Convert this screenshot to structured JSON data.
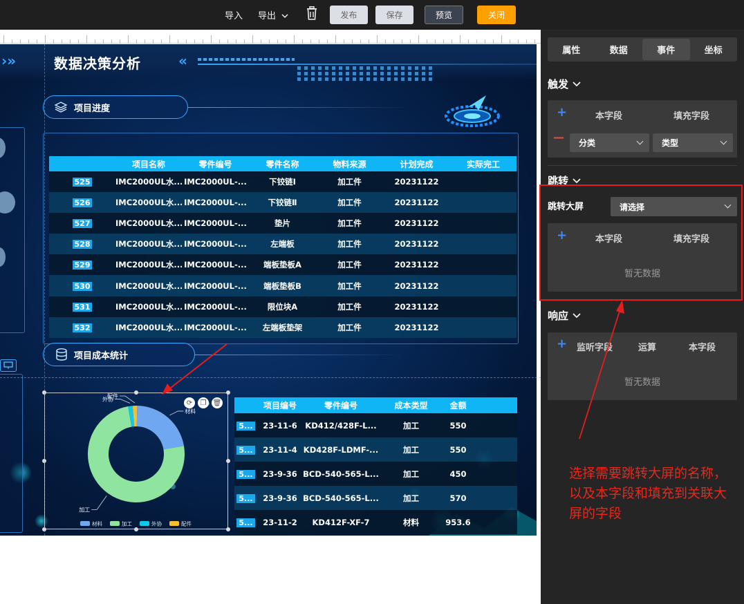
{
  "toolbar": {
    "import_label": "导入",
    "export_label": "导出",
    "publish_label": "发布",
    "save_label": "保存",
    "preview_label": "预览",
    "close_label": "关闭",
    "accent_orange": "#ff9f00"
  },
  "screen": {
    "title": "数据决策分析",
    "section_progress": "项目进度",
    "section_cost": "项目成本统计"
  },
  "progress_table": {
    "headers": [
      "",
      "项目名称",
      "零件编号",
      "零件名称",
      "物料来源",
      "计划完成",
      "实际完工"
    ],
    "rows": [
      {
        "id": "525",
        "name": "IMC2000UL水...",
        "part_no": "IMC2000UL-...",
        "part_name": "下铰链Ⅰ",
        "source": "加工件",
        "plan": "20231122",
        "actual": ""
      },
      {
        "id": "526",
        "name": "IMC2000UL水...",
        "part_no": "IMC2000UL-...",
        "part_name": "下铰链Ⅱ",
        "source": "加工件",
        "plan": "20231122",
        "actual": ""
      },
      {
        "id": "527",
        "name": "IMC2000UL水...",
        "part_no": "IMC2000UL-...",
        "part_name": "垫片",
        "source": "加工件",
        "plan": "20231122",
        "actual": ""
      },
      {
        "id": "528",
        "name": "IMC2000UL水...",
        "part_no": "IMC2000UL-...",
        "part_name": "左端板",
        "source": "加工件",
        "plan": "20231122",
        "actual": ""
      },
      {
        "id": "529",
        "name": "IMC2000UL水...",
        "part_no": "IMC2000UL-...",
        "part_name": "端板垫板A",
        "source": "加工件",
        "plan": "20231122",
        "actual": ""
      },
      {
        "id": "530",
        "name": "IMC2000UL水...",
        "part_no": "IMC2000UL-...",
        "part_name": "端板垫板B",
        "source": "加工件",
        "plan": "20231122",
        "actual": ""
      },
      {
        "id": "531",
        "name": "IMC2000UL水...",
        "part_no": "IMC2000UL-...",
        "part_name": "限位块A",
        "source": "加工件",
        "plan": "20231122",
        "actual": ""
      },
      {
        "id": "532",
        "name": "IMC2000UL水...",
        "part_no": "IMC2000UL-...",
        "part_name": "左端板垫架",
        "source": "加工件",
        "plan": "20231122",
        "actual": ""
      }
    ]
  },
  "cost_table": {
    "headers": [
      "",
      "项目编号",
      "零件编号",
      "成本类型",
      "金额"
    ],
    "rows": [
      {
        "id": "5...",
        "proj": "23-11-6",
        "part_no": "KD412/428F-L...",
        "type": "加工",
        "amount": "550"
      },
      {
        "id": "5...",
        "proj": "23-11-4",
        "part_no": "KD428F-LDMF-...",
        "type": "加工",
        "amount": "550"
      },
      {
        "id": "5...",
        "proj": "23-9-36",
        "part_no": "BCD-540-565-L...",
        "type": "加工",
        "amount": "450"
      },
      {
        "id": "5...",
        "proj": "23-9-36",
        "part_no": "BCD-540-565-L...",
        "type": "加工",
        "amount": "570"
      },
      {
        "id": "5...",
        "proj": "23-11-2",
        "part_no": "KD412F-XF-7",
        "type": "材料",
        "amount": "953.6"
      }
    ]
  },
  "chart_data": {
    "type": "pie",
    "categories": [
      "材料",
      "加工",
      "外协",
      "配件"
    ],
    "values": [
      22,
      75,
      1.5,
      1.5
    ],
    "colors": [
      "#6fa8f0",
      "#8fe4a0",
      "#10c8e8",
      "#f5c030"
    ],
    "legend_position": "bottom"
  },
  "right_panel": {
    "tabs": [
      "属性",
      "数据",
      "事件",
      "坐标"
    ],
    "active_tab": "事件",
    "trigger": {
      "title": "触发",
      "col_this": "本字段",
      "col_fill": "填充字段",
      "select_category": "分类",
      "select_type": "类型"
    },
    "jump": {
      "title": "跳转",
      "screen_label": "跳转大屏",
      "screen_select": "请选择",
      "col_this": "本字段",
      "col_fill": "填充字段",
      "empty": "暂无数据"
    },
    "response": {
      "title": "响应",
      "col_listen": "监听字段",
      "col_op": "运算",
      "col_this": "本字段",
      "empty": "暂无数据"
    }
  },
  "annotation": {
    "text": "选择需要跳转大屏的名称，以及本字段和填充到关联大屏的字段",
    "color": "#e8281c"
  }
}
